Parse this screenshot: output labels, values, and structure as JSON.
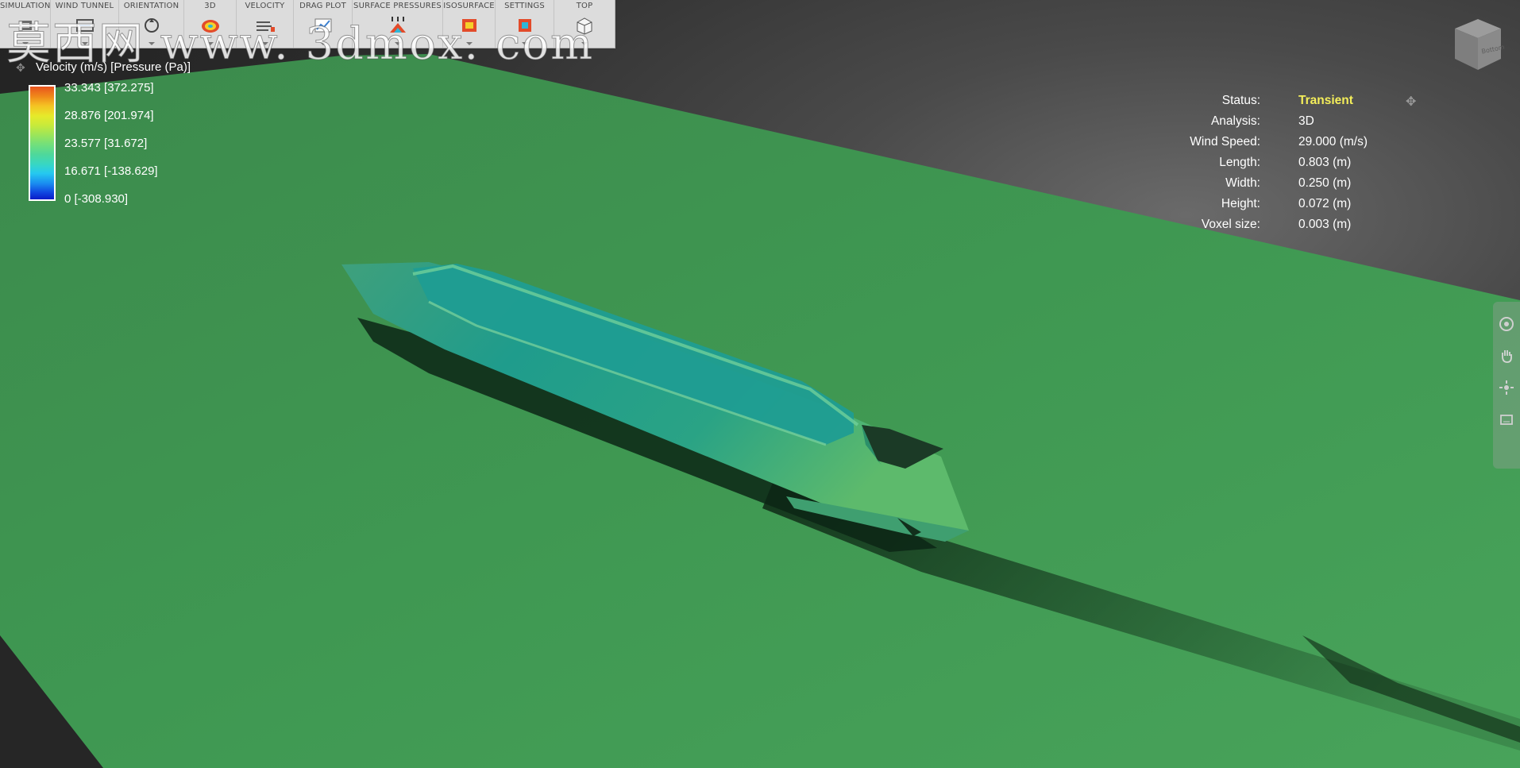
{
  "toolbar": {
    "groups": [
      {
        "label": "SIMULATION",
        "icon": "simulation-icon"
      },
      {
        "label": "WIND TUNNEL",
        "icon": "wind-tunnel-icon"
      },
      {
        "label": "ORIENTATION",
        "icon": "orientation-icon"
      },
      {
        "label": "3D",
        "icon": "3d-icon"
      },
      {
        "label": "VELOCITY",
        "icon": "velocity-icon"
      },
      {
        "label": "DRAG PLOT",
        "icon": "drag-plot-icon"
      },
      {
        "label": "SURFACE PRESSURES",
        "icon": "surface-pressures-icon"
      },
      {
        "label": "ISOSURFACE",
        "icon": "isosurface-icon"
      },
      {
        "label": "SETTINGS",
        "icon": "settings-icon"
      },
      {
        "label": "TOP",
        "icon": "top-view-icon"
      }
    ]
  },
  "watermark": {
    "text": "莫西网 www. 3dmox. com"
  },
  "legend": {
    "title": "Velocity (m/s) [Pressure (Pa)]",
    "values": [
      "33.343 [372.275]",
      "28.876 [201.974]",
      "23.577 [31.672]",
      "16.671 [-138.629]",
      "0 [-308.930]"
    ],
    "colors": {
      "max": "#e8531e",
      "mid": "#74e07a",
      "min": "#0a1cc8"
    }
  },
  "info": {
    "rows": [
      {
        "label": "Status:",
        "value": "Transient"
      },
      {
        "label": "Analysis:",
        "value": "3D"
      },
      {
        "label": "Wind Speed:",
        "value": "29.000 (m/s)"
      },
      {
        "label": "Length:",
        "value": "0.803 (m)"
      },
      {
        "label": "Width:",
        "value": "0.250 (m)"
      },
      {
        "label": "Height:",
        "value": "0.072 (m)"
      },
      {
        "label": "Voxel size:",
        "value": "0.003 (m)"
      }
    ],
    "status_color": "#f4ee5a"
  },
  "viewcube": {
    "face_label": "Bottom"
  },
  "navbar": {
    "items": [
      "steering-wheel-icon",
      "pan-hand-icon",
      "orbit-icon",
      "zoom-extents-icon"
    ]
  },
  "colors": {
    "ground": "#3f9550",
    "ship": "#27a58c",
    "background": "#3a3a3a"
  }
}
